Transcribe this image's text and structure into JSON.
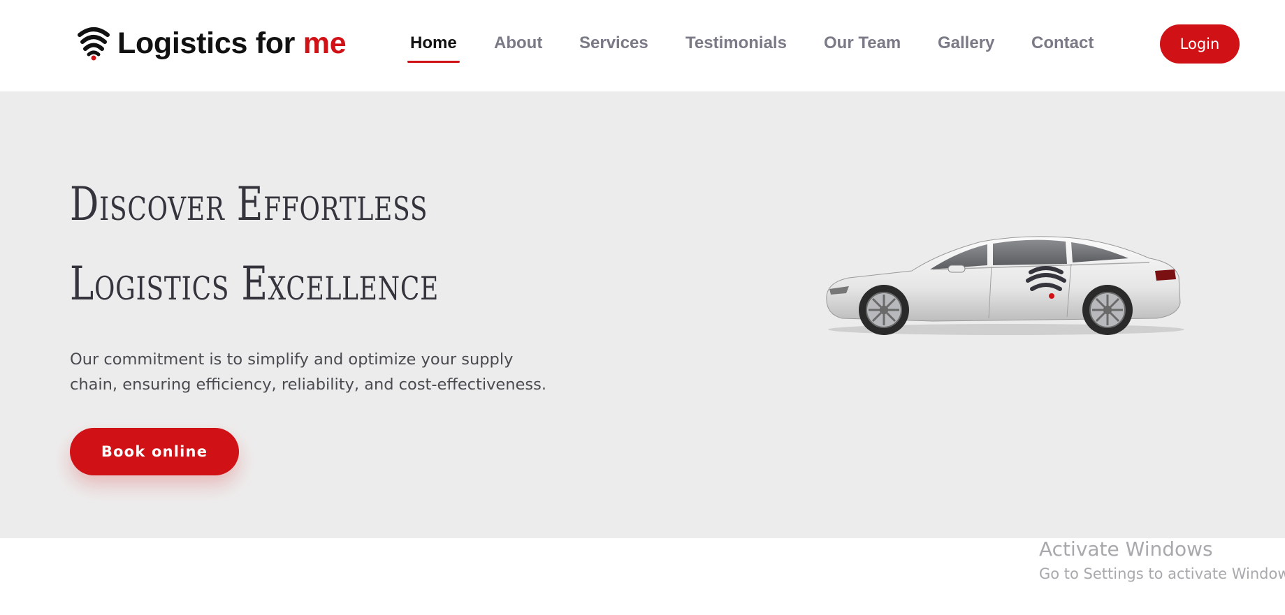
{
  "header": {
    "brand_prefix": "Logistics for ",
    "brand_accent": "me",
    "logo_icon": "wifi-signal-logo-icon",
    "nav": [
      {
        "label": "Home",
        "active": true
      },
      {
        "label": "About",
        "active": false
      },
      {
        "label": "Services",
        "active": false
      },
      {
        "label": "Testimonials",
        "active": false
      },
      {
        "label": "Our Team",
        "active": false
      },
      {
        "label": "Gallery",
        "active": false
      },
      {
        "label": "Contact",
        "active": false
      }
    ],
    "login_label": "Login"
  },
  "hero": {
    "title_line1": "Discover Effortless",
    "title_line2": "Logistics Excellence",
    "subtitle_line1": "Our commitment is to simplify and optimize your supply",
    "subtitle_line2": "chain, ensuring efficiency, reliability, and cost-effectiveness.",
    "cta_label": "Book online",
    "image": "white-sedan-car-with-logo"
  },
  "watermark": {
    "title": "Activate Windows",
    "subtitle": "Go to Settings to activate Windows."
  },
  "colors": {
    "accent": "#d01217",
    "hero_bg": "#edecec",
    "nav_inactive": "#7a7a86",
    "text_dark": "#35343d"
  }
}
